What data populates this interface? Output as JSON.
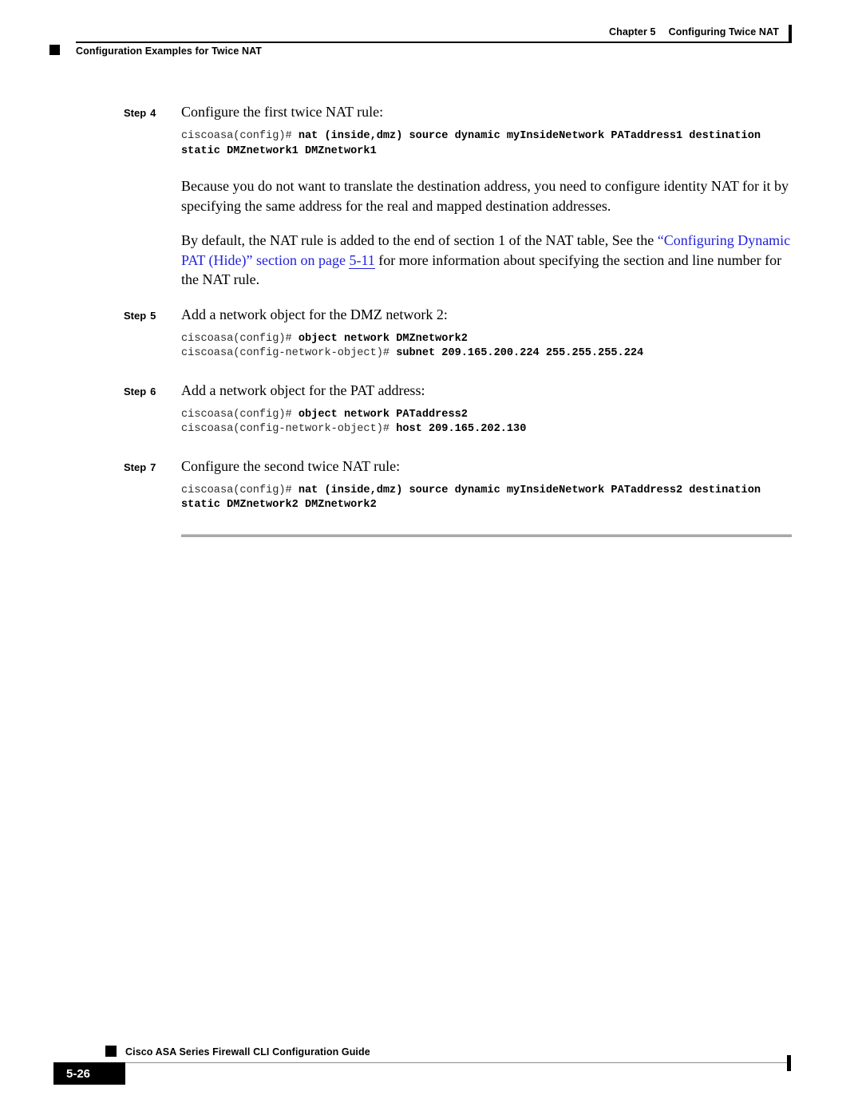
{
  "header": {
    "chapter_number": "Chapter 5",
    "chapter_title": "Configuring Twice NAT",
    "section_title": "Configuration Examples for Twice NAT"
  },
  "steps": [
    {
      "label_word": "Step",
      "label_number": "4",
      "text": "Configure the first twice NAT rule:",
      "code": [
        {
          "prompt": "ciscoasa(config)# ",
          "command": "nat (inside,dmz) source dynamic myInsideNetwork PATaddress1 destination"
        },
        {
          "prompt": "",
          "command": "static DMZnetwork1 DMZnetwork1"
        }
      ]
    },
    {
      "label_word": "Step",
      "label_number": "5",
      "text": "Add a network object for the DMZ network 2:",
      "code": [
        {
          "prompt": "ciscoasa(config)# ",
          "command": "object network DMZnetwork2"
        },
        {
          "prompt": "ciscoasa(config-network-object)# ",
          "command": "subnet 209.165.200.224 255.255.255.224"
        }
      ]
    },
    {
      "label_word": "Step",
      "label_number": "6",
      "text": "Add a network object for the PAT address:",
      "code": [
        {
          "prompt": "ciscoasa(config)# ",
          "command": "object network PATaddress2"
        },
        {
          "prompt": "ciscoasa(config-network-object)# ",
          "command": "host 209.165.202.130"
        }
      ]
    },
    {
      "label_word": "Step",
      "label_number": "7",
      "text": "Configure the second twice NAT rule:",
      "code": [
        {
          "prompt": "ciscoasa(config)# ",
          "command": "nat (inside,dmz) source dynamic myInsideNetwork PATaddress2 destination"
        },
        {
          "prompt": "",
          "command": "static DMZnetwork2 DMZnetwork2"
        }
      ]
    }
  ],
  "paragraphs": {
    "identity_nat": "Because you do not want to translate the destination address, you need to configure identity NAT for it by specifying the same address for the real and mapped destination addresses.",
    "default_rule_pre": "By default, the NAT rule is added to the end of section 1 of the NAT table, See the ",
    "default_rule_link": "“Configuring Dynamic PAT (Hide)” section on page ",
    "default_rule_link_page": "5-11",
    "default_rule_post": " for more information about specifying the section and line number for the NAT rule."
  },
  "footer": {
    "guide_title": "Cisco ASA Series Firewall CLI Configuration Guide",
    "page_number": "5-26"
  },
  "colors": {
    "link": "#2222dd",
    "rule_gray": "#a8a8a8",
    "text": "#000000"
  }
}
